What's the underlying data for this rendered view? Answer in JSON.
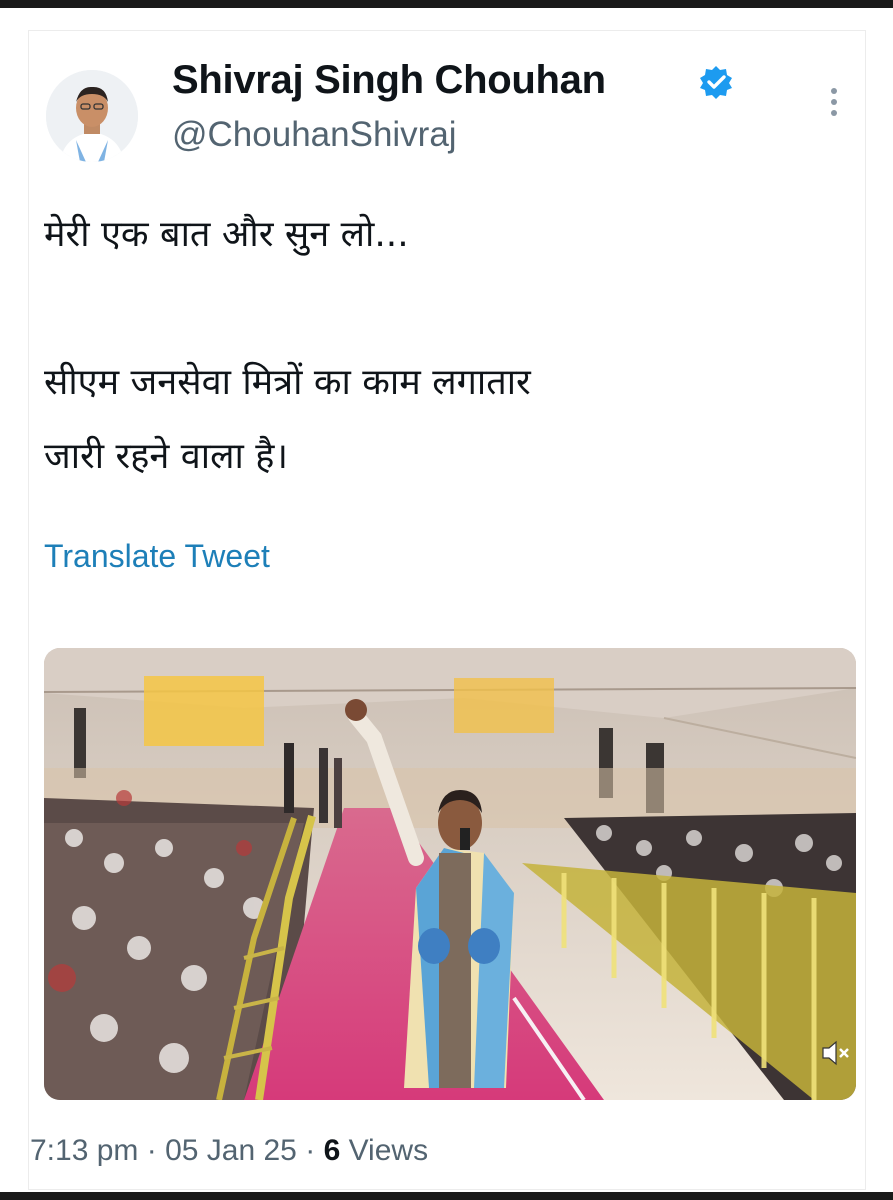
{
  "tweet": {
    "author": {
      "display_name": "Shivraj Singh Chouhan",
      "handle": "@ChouhanShivraj",
      "verified": true,
      "avatar_icon": "profile-photo"
    },
    "text_lines": [
      "मेरी एक बात और सुन लो...",
      "सीएम जनसेवा मित्रों का काम लगातार",
      "जारी रहने वाला है।"
    ],
    "translate_label": "Translate Tweet",
    "media": {
      "type": "video",
      "muted_icon": "speaker-muted-icon"
    },
    "meta": {
      "time": "7:13 pm",
      "separator": "·",
      "date": "05 Jan 25",
      "views_count": "6",
      "views_label": "Views"
    }
  },
  "colors": {
    "text_primary": "#0f1419",
    "text_secondary": "#536471",
    "link": "#1d7fb8",
    "verified": "#1d9bf0",
    "carpet": "#d63a7a"
  }
}
